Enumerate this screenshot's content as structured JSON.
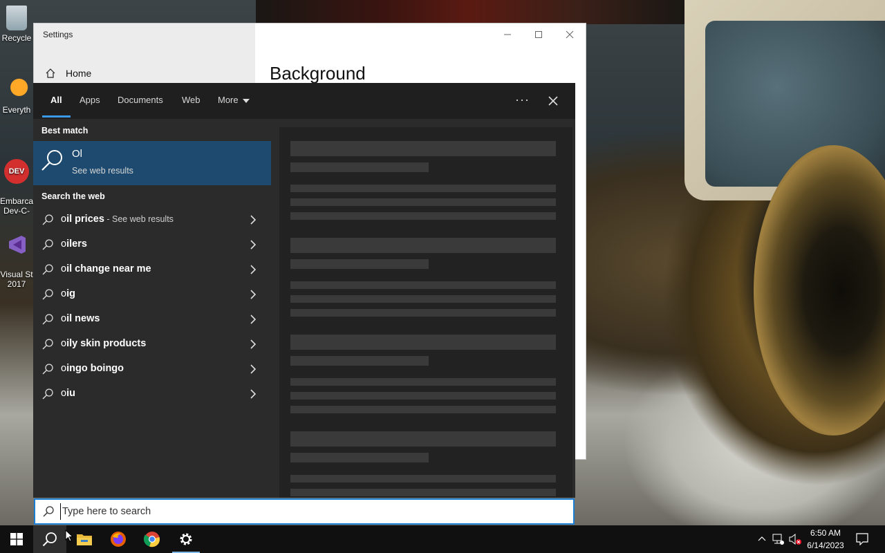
{
  "desktop": {
    "icons": [
      {
        "label": "Recycle"
      },
      {
        "label": "Everyth"
      },
      {
        "label": "Embarca\nDev-C-"
      },
      {
        "label": "Visual St\n2017"
      }
    ]
  },
  "settings_window": {
    "title": "Settings",
    "nav_home": "Home",
    "page_heading": "Background"
  },
  "search": {
    "tabs": [
      {
        "label": "All",
        "active": true
      },
      {
        "label": "Apps"
      },
      {
        "label": "Documents"
      },
      {
        "label": "Web"
      },
      {
        "label": "More"
      }
    ],
    "ellipsis": "···",
    "best_match_label": "Best match",
    "best_match": {
      "title": "Ol",
      "subtitle": "See web results"
    },
    "search_web_label": "Search the web",
    "suggestions": [
      {
        "prefix": "o",
        "bold": "il prices",
        "sub": " - See web results"
      },
      {
        "prefix": "o",
        "bold": "ilers",
        "sub": ""
      },
      {
        "prefix": "o",
        "bold": "il change near me",
        "sub": ""
      },
      {
        "prefix": "o",
        "bold": "ig",
        "sub": ""
      },
      {
        "prefix": "o",
        "bold": "il news",
        "sub": ""
      },
      {
        "prefix": "o",
        "bold": "ily skin products",
        "sub": ""
      },
      {
        "prefix": "o",
        "bold": "ingo boingo",
        "sub": ""
      },
      {
        "prefix": "o",
        "bold": "iu",
        "sub": ""
      }
    ],
    "input_value": "",
    "input_placeholder": "Type here to search"
  },
  "taskbar": {
    "pinned": [
      "start-icon",
      "search-icon",
      "file-explorer-icon",
      "firefox-icon",
      "chrome-icon",
      "settings-icon"
    ],
    "clock_time": "6:50 AM",
    "clock_date": "6/14/2023"
  },
  "colors": {
    "accent": "#1a7fd4",
    "best_match_bg": "#1d4a6e",
    "panel_bg": "#2b2b2b"
  }
}
